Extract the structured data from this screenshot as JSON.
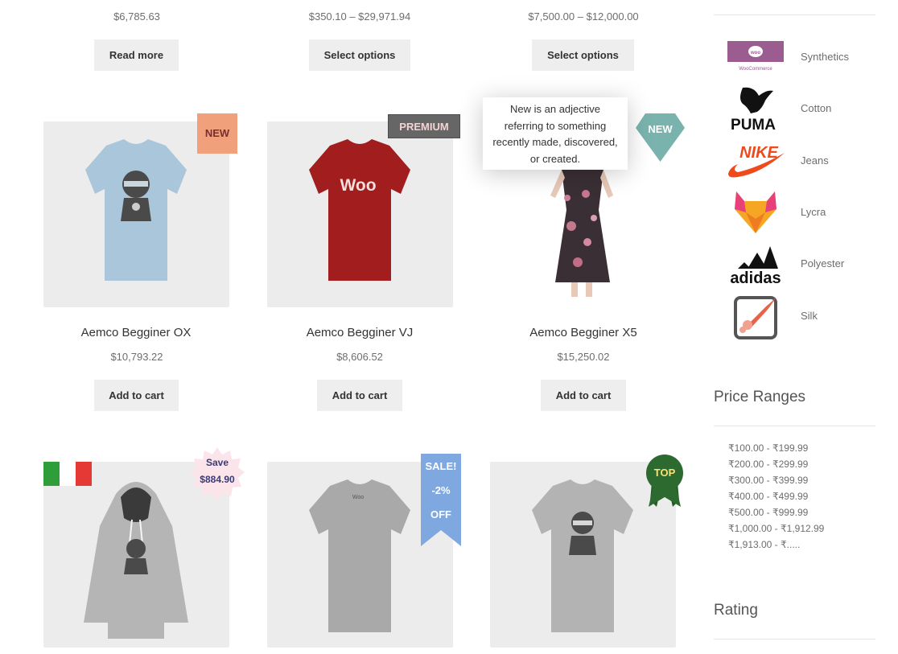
{
  "top_row": {
    "prices": [
      "$6,785.63",
      "$350.10 – $29,971.94",
      "$7,500.00 – $12,000.00"
    ],
    "buttons": [
      "Read more",
      "Select options",
      "Select options"
    ]
  },
  "products": [
    {
      "title": "Aemco Begginer OX",
      "price": "$10,793.22",
      "button": "Add to cart",
      "badge": "NEW",
      "badge_color": "#f0a07a",
      "badge_text_color": "#7a2e2e"
    },
    {
      "title": "Aemco Begginer VJ",
      "price": "$8,606.52",
      "button": "Add to cart",
      "badge": "PREMIUM",
      "badge_color": "#666666",
      "badge_text_color": "#f6d3d3"
    },
    {
      "title": "Aemco Begginer X5",
      "price": "$15,250.02",
      "button": "Add to cart",
      "badge": "NEW",
      "badge_color": "#7ab3ae",
      "badge_text_color": "#ffffff"
    }
  ],
  "tooltip": {
    "text": "New is an adjective referring to something recently made, discovered, or created."
  },
  "bottom_badges": {
    "save_label": "Save",
    "save_amount": "$884.90",
    "sale_lines": [
      "SALE!",
      "-2%",
      "OFF"
    ],
    "top_label": "TOP"
  },
  "brands": [
    {
      "logo": "woocommerce-logo",
      "logo_text": "WooCommerce",
      "label": "Synthetics"
    },
    {
      "logo": "puma-logo",
      "logo_text": "PUMA",
      "label": "Cotton"
    },
    {
      "logo": "nike-logo",
      "logo_text": "NIKE",
      "label": "Jeans"
    },
    {
      "logo": "fox-logo",
      "logo_text": "",
      "label": "Lycra"
    },
    {
      "logo": "adidas-logo",
      "logo_text": "adidas",
      "label": "Polyester"
    },
    {
      "logo": "rocket-logo",
      "logo_text": "",
      "label": "Silk"
    }
  ],
  "price_ranges": {
    "title": "Price Ranges",
    "items": [
      "₹100.00 - ₹199.99",
      "₹200.00 - ₹299.99",
      "₹300.00 - ₹399.99",
      "₹400.00 - ₹499.99",
      "₹500.00 - ₹999.99",
      "₹1,000.00 - ₹1,912.99",
      "₹1,913.00 - ₹....."
    ]
  },
  "rating": {
    "title": "Rating"
  },
  "colors": {
    "button_bg": "#eeeeee",
    "image_bg": "#ececec",
    "accent": "#96588a"
  }
}
